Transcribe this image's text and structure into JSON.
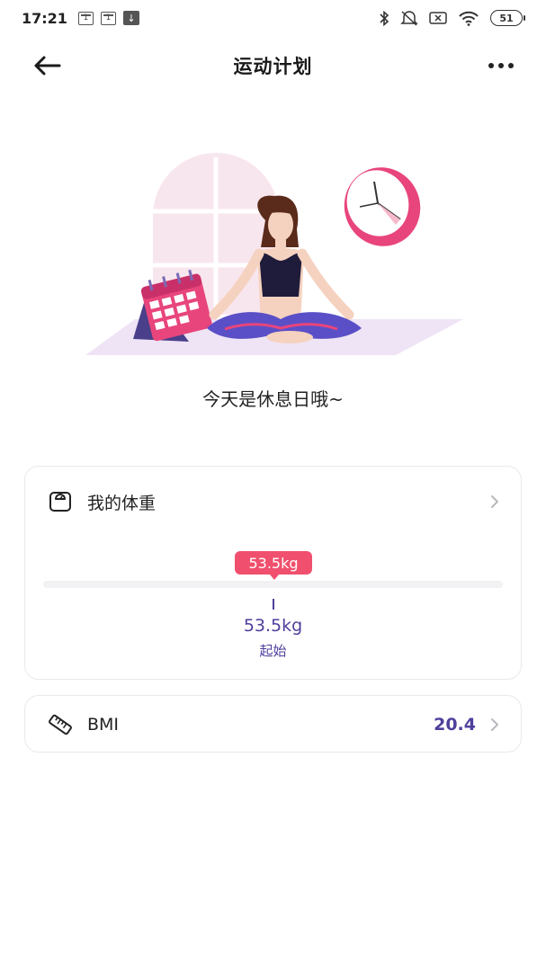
{
  "status_bar": {
    "time": "17:21",
    "notif1": "1",
    "notif2": "1",
    "battery": "51",
    "icons": [
      "sim-notification-icon",
      "sim-notification-icon",
      "download-icon",
      "bluetooth-icon",
      "mute-icon",
      "no-sim-icon",
      "wifi-icon",
      "battery-icon"
    ]
  },
  "header": {
    "title": "运动计划",
    "back_icon": "arrow-left-icon",
    "more_icon": "more-dots-icon"
  },
  "illustration": {
    "icon": "yoga-rest-illustration"
  },
  "rest_message": "今天是休息日哦~",
  "weight_card": {
    "label": "我的体重",
    "icon": "scale-icon",
    "current_value": "53.5kg",
    "progress_fraction": 0,
    "start_value": "53.5kg",
    "start_label": "起始"
  },
  "bmi_card": {
    "label": "BMI",
    "icon": "ruler-icon",
    "value": "20.4"
  },
  "colors": {
    "accent_purple": "#4f3f9c",
    "accent_pink": "#f0506e"
  }
}
